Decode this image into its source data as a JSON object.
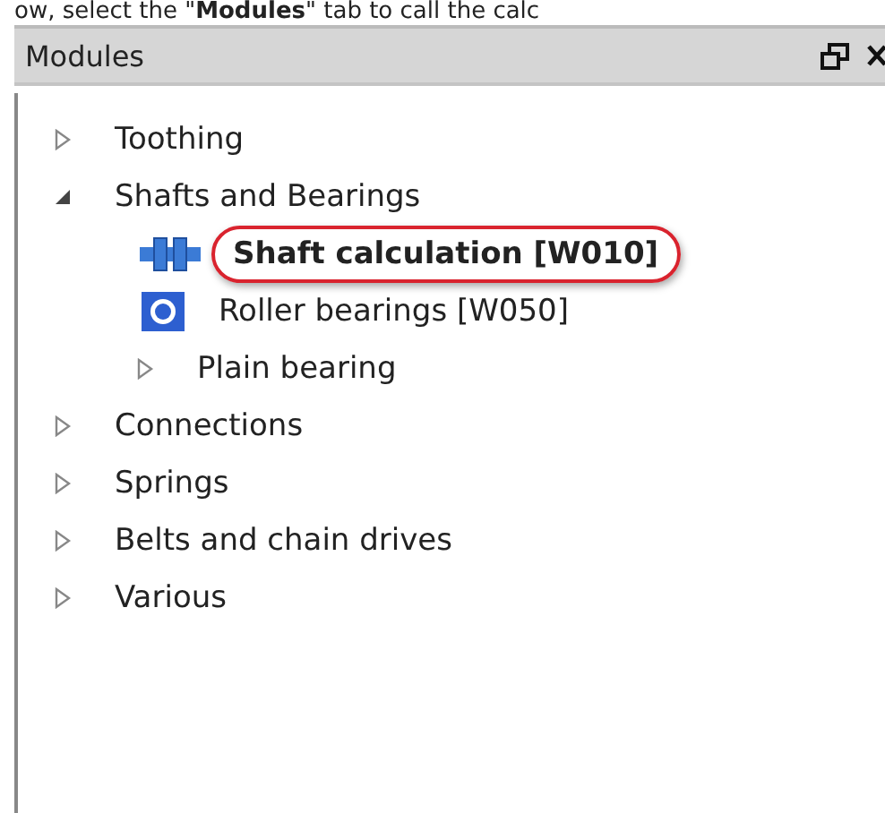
{
  "caption": "ow, select the \"**Modules**\" tab to call the calc",
  "panel": {
    "title": "Modules"
  },
  "tree": [
    {
      "label": "Toothing",
      "kind": "group",
      "expanded": false,
      "selected": false
    },
    {
      "label": "Shafts and Bearings",
      "kind": "group",
      "expanded": true,
      "selected": false,
      "children": [
        {
          "label": "Shaft calculation [W010]",
          "kind": "shaft-module",
          "selected": true
        },
        {
          "label": "Roller bearings [W050]",
          "kind": "bearing-module",
          "selected": false
        },
        {
          "label": "Plain bearing",
          "kind": "group",
          "expanded": false,
          "selected": false
        }
      ]
    },
    {
      "label": "Connections",
      "kind": "group",
      "expanded": false,
      "selected": false
    },
    {
      "label": "Springs",
      "kind": "group",
      "expanded": false,
      "selected": false
    },
    {
      "label": "Belts and chain drives",
      "kind": "group",
      "expanded": false,
      "selected": false
    },
    {
      "label": "Various",
      "kind": "group",
      "expanded": false,
      "selected": false
    }
  ]
}
